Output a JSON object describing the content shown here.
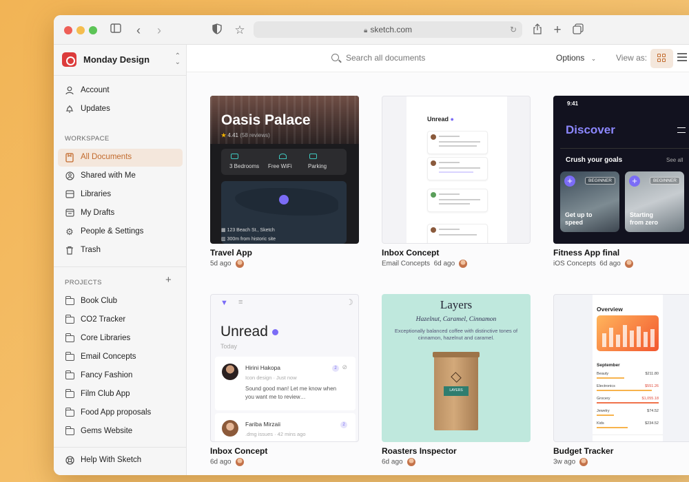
{
  "browser": {
    "url": "sketch.com"
  },
  "sidebar": {
    "team_name": "Monday Design",
    "account_items": [
      {
        "label": "Account",
        "icon": "person-icon"
      },
      {
        "label": "Updates",
        "icon": "bell-icon"
      }
    ],
    "workspace_heading": "WORKSPACE",
    "workspace_items": [
      {
        "label": "All Documents",
        "icon": "documents-icon",
        "active": true
      },
      {
        "label": "Shared with Me",
        "icon": "shared-icon"
      },
      {
        "label": "Libraries",
        "icon": "library-icon"
      },
      {
        "label": "My Drafts",
        "icon": "drafts-icon"
      },
      {
        "label": "People & Settings",
        "icon": "gear-icon"
      },
      {
        "label": "Trash",
        "icon": "trash-icon"
      }
    ],
    "projects_heading": "PROJECTS",
    "projects": [
      "Book Club",
      "CO2 Tracker",
      "Core Libraries",
      "Email Concepts",
      "Fancy Fashion",
      "Film Club App",
      "Food App proposals",
      "Gems Website"
    ],
    "help_label": "Help With Sketch"
  },
  "topbar": {
    "search_placeholder": "Search all documents",
    "options_label": "Options",
    "view_as_label": "View as:"
  },
  "documents": [
    {
      "title": "Travel App",
      "project": "",
      "time": "5d ago"
    },
    {
      "title": " Inbox Concept",
      "project": "Email Concepts",
      "time": "6d ago"
    },
    {
      "title": "Fitness App final",
      "project": "iOS Concepts",
      "time": "6d ago"
    },
    {
      "title": " Inbox Concept",
      "project": "",
      "time": "6d ago"
    },
    {
      "title": "Roasters Inspector",
      "project": "",
      "time": "6d ago"
    },
    {
      "title": "Budget Tracker",
      "project": "",
      "time": "3w ago"
    }
  ],
  "thumbs": {
    "travel": {
      "name": "Oasis Palace",
      "rating": "4.41",
      "reviews": "(58 reviews)",
      "amenities": [
        "3 Bedrooms",
        "Free WiFi",
        "Parking"
      ],
      "address": "123 Beach St., Sketch",
      "distance": "300m from historic site"
    },
    "inbox_small": {
      "heading": "Unread"
    },
    "fitness": {
      "time": "9:41",
      "heading": "Discover",
      "section": "Crush your goals",
      "see_all": "See all",
      "badge": "BEGINNER",
      "tiles": [
        "Get up to speed",
        "Starting from zero"
      ]
    },
    "inbox_large": {
      "heading": "Unread",
      "today": "Today",
      "messages": [
        {
          "name": "Hirini Hakopa",
          "sub": "Icon design · Just now",
          "text": "Sound good man! Let me know when you want me to review…",
          "count": "2"
        },
        {
          "name": "Fariba Mirzaii",
          "sub": ".dmg issues · 42 mins ago",
          "text": "",
          "count": "2"
        }
      ]
    },
    "layers": {
      "title": "Layers",
      "subtitle": "Hazelnut, Caramel, Cinnamon",
      "description": "Exceptionally balanced coffee with distinctive tones of cinnamon, hazelnut and caramel.",
      "bag_label": "LAYERS"
    },
    "budget": {
      "heading": "Overview",
      "month": "September",
      "rows": [
        {
          "label": "Beauty",
          "value": "$211.80"
        },
        {
          "label": "Electronics",
          "value": "$551.26"
        },
        {
          "label": "Grocery",
          "value": "$1,055.18"
        },
        {
          "label": "Jewelry",
          "value": "$74.52"
        },
        {
          "label": "Kids",
          "value": "$234.52"
        }
      ]
    }
  },
  "colors": {
    "accent": "#c26a2c",
    "active_bg": "#f4e7dc",
    "brand": "#dc3b3b",
    "purple": "#7b6cf6"
  }
}
